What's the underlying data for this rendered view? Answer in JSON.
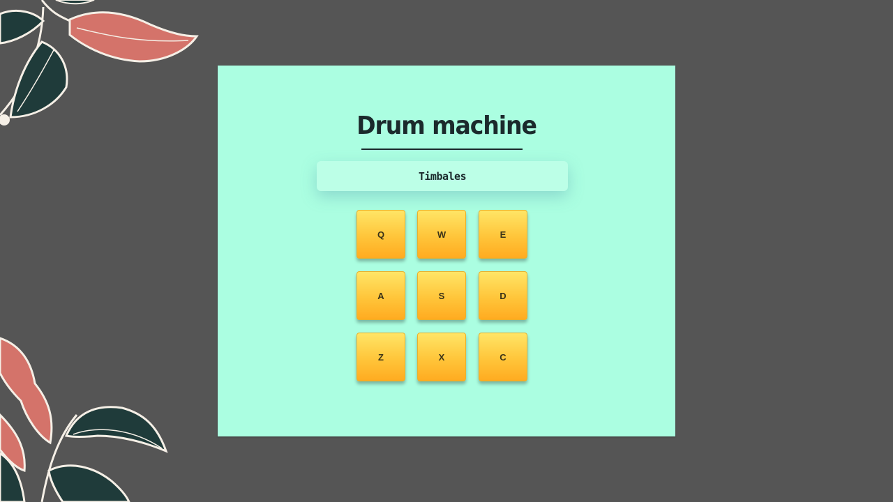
{
  "app": {
    "title": "Drum machine",
    "display_text": "Timbales"
  },
  "pads": [
    {
      "key": "Q"
    },
    {
      "key": "W"
    },
    {
      "key": "E"
    },
    {
      "key": "A"
    },
    {
      "key": "S"
    },
    {
      "key": "D"
    },
    {
      "key": "Z"
    },
    {
      "key": "X"
    },
    {
      "key": "C"
    }
  ],
  "colors": {
    "background": "#555555",
    "card": "#abfee1",
    "display": "#bcffe7",
    "pad_top": "#ffe566",
    "pad_bottom": "#ffab20",
    "leaf_coral": "#d4736a",
    "leaf_dark": "#1f3b3a"
  }
}
